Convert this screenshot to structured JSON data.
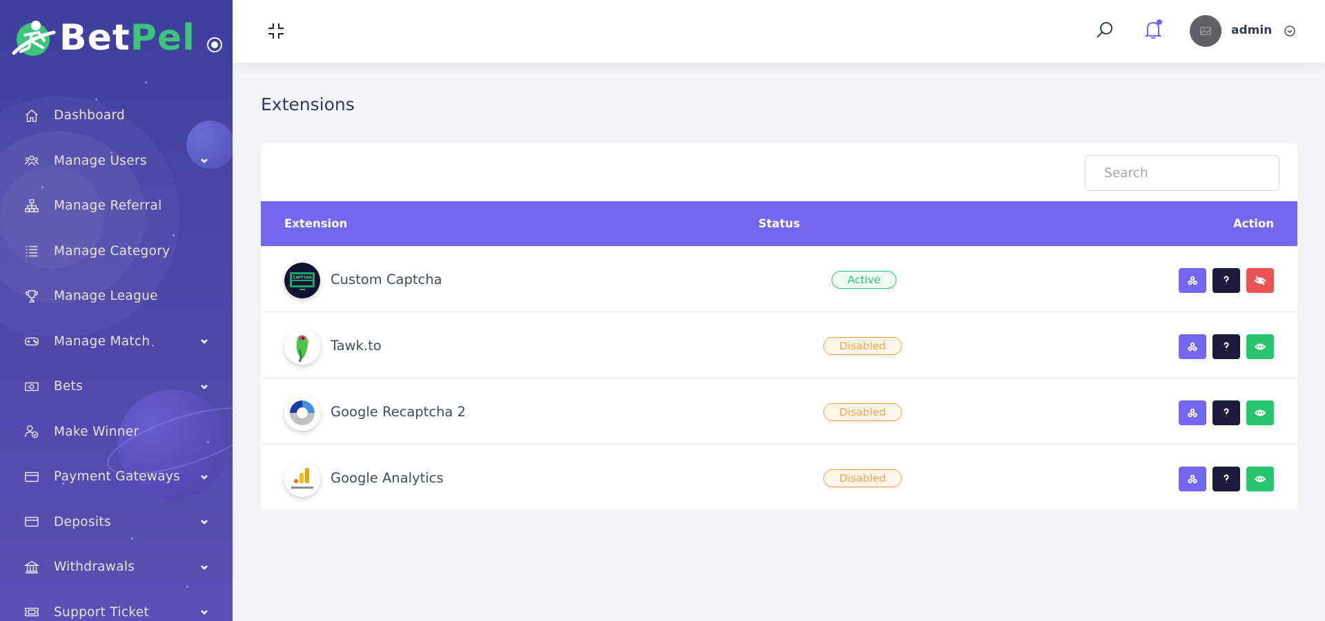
{
  "brand": {
    "part1": "Bet",
    "part2": "Pel"
  },
  "sidebar": {
    "items": [
      {
        "label": "Dashboard",
        "icon": "home-icon",
        "has_submenu": false
      },
      {
        "label": "Manage Users",
        "icon": "users-icon",
        "has_submenu": true
      },
      {
        "label": "Manage Referral",
        "icon": "sitemap-icon",
        "has_submenu": false
      },
      {
        "label": "Manage Category",
        "icon": "list-icon",
        "has_submenu": false
      },
      {
        "label": "Manage League",
        "icon": "trophy-icon",
        "has_submenu": false
      },
      {
        "label": "Manage Match",
        "icon": "gamepad-icon",
        "has_submenu": true
      },
      {
        "label": "Bets",
        "icon": "money-bill-icon",
        "has_submenu": true
      },
      {
        "label": "Make Winner",
        "icon": "user-check-icon",
        "has_submenu": false
      },
      {
        "label": "Payment Gateways",
        "icon": "credit-card-icon",
        "has_submenu": true
      },
      {
        "label": "Deposits",
        "icon": "credit-card-icon",
        "has_submenu": true
      },
      {
        "label": "Withdrawals",
        "icon": "bank-icon",
        "has_submenu": true
      },
      {
        "label": "Support Ticket",
        "icon": "ticket-icon",
        "has_submenu": true
      }
    ]
  },
  "header": {
    "user_name": "admin"
  },
  "page": {
    "title": "Extensions"
  },
  "table": {
    "search_placeholder": "Search",
    "search_value": "",
    "columns": [
      "Extension",
      "Status",
      "Action"
    ],
    "rows": [
      {
        "name": "Custom Captcha",
        "status": "Active",
        "status_type": "active",
        "logo": "captcha-logo",
        "toggle_action": "disable"
      },
      {
        "name": "Tawk.to",
        "status": "Disabled",
        "status_type": "disabled",
        "logo": "parrot-logo",
        "toggle_action": "enable"
      },
      {
        "name": "Google Recaptcha 2",
        "status": "Disabled",
        "status_type": "disabled",
        "logo": "recaptcha-logo",
        "toggle_action": "enable"
      },
      {
        "name": "Google Analytics",
        "status": "Disabled",
        "status_type": "disabled",
        "logo": "analytics-logo",
        "toggle_action": "enable"
      }
    ]
  },
  "colors": {
    "sidebar": "#4a46a8",
    "accent": "#7367f0",
    "success": "#28c76f",
    "warning": "#ff9f43",
    "danger": "#ea5455",
    "dark": "#1b1a3a",
    "brand_green": "#3cc57a"
  }
}
